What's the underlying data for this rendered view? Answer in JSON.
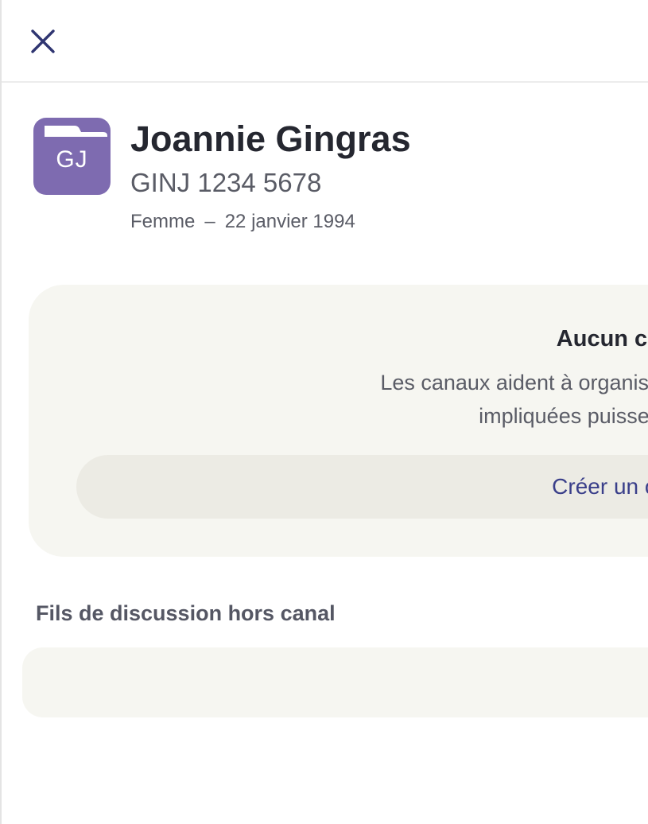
{
  "header": {
    "close_icon": "close-icon",
    "close_color": "#2f3571"
  },
  "patient": {
    "initials": "GJ",
    "name": "Joannie Gingras",
    "health_id": "GINJ 1234 5678",
    "sex": "Femme",
    "separator": "–",
    "birth_date": "22 janvier 1994",
    "avatar_color": "#7e6bb0",
    "avatar_icon": "folder-icon"
  },
  "channels_empty": {
    "title": "Aucun canal",
    "description_line1": "Les canaux aident à organiser les fils de discussion",
    "description_line2": "impliquées puissent facilement",
    "create_button_label": "Créer un canal"
  },
  "threads": {
    "section_title": "Fils de discussion hors canal",
    "items": []
  },
  "colors": {
    "card_background": "#f6f6f1",
    "button_background": "#ecebe4",
    "accent_text": "#3a3f8a",
    "primary_text": "#252730",
    "secondary_text": "#5a5c66"
  }
}
